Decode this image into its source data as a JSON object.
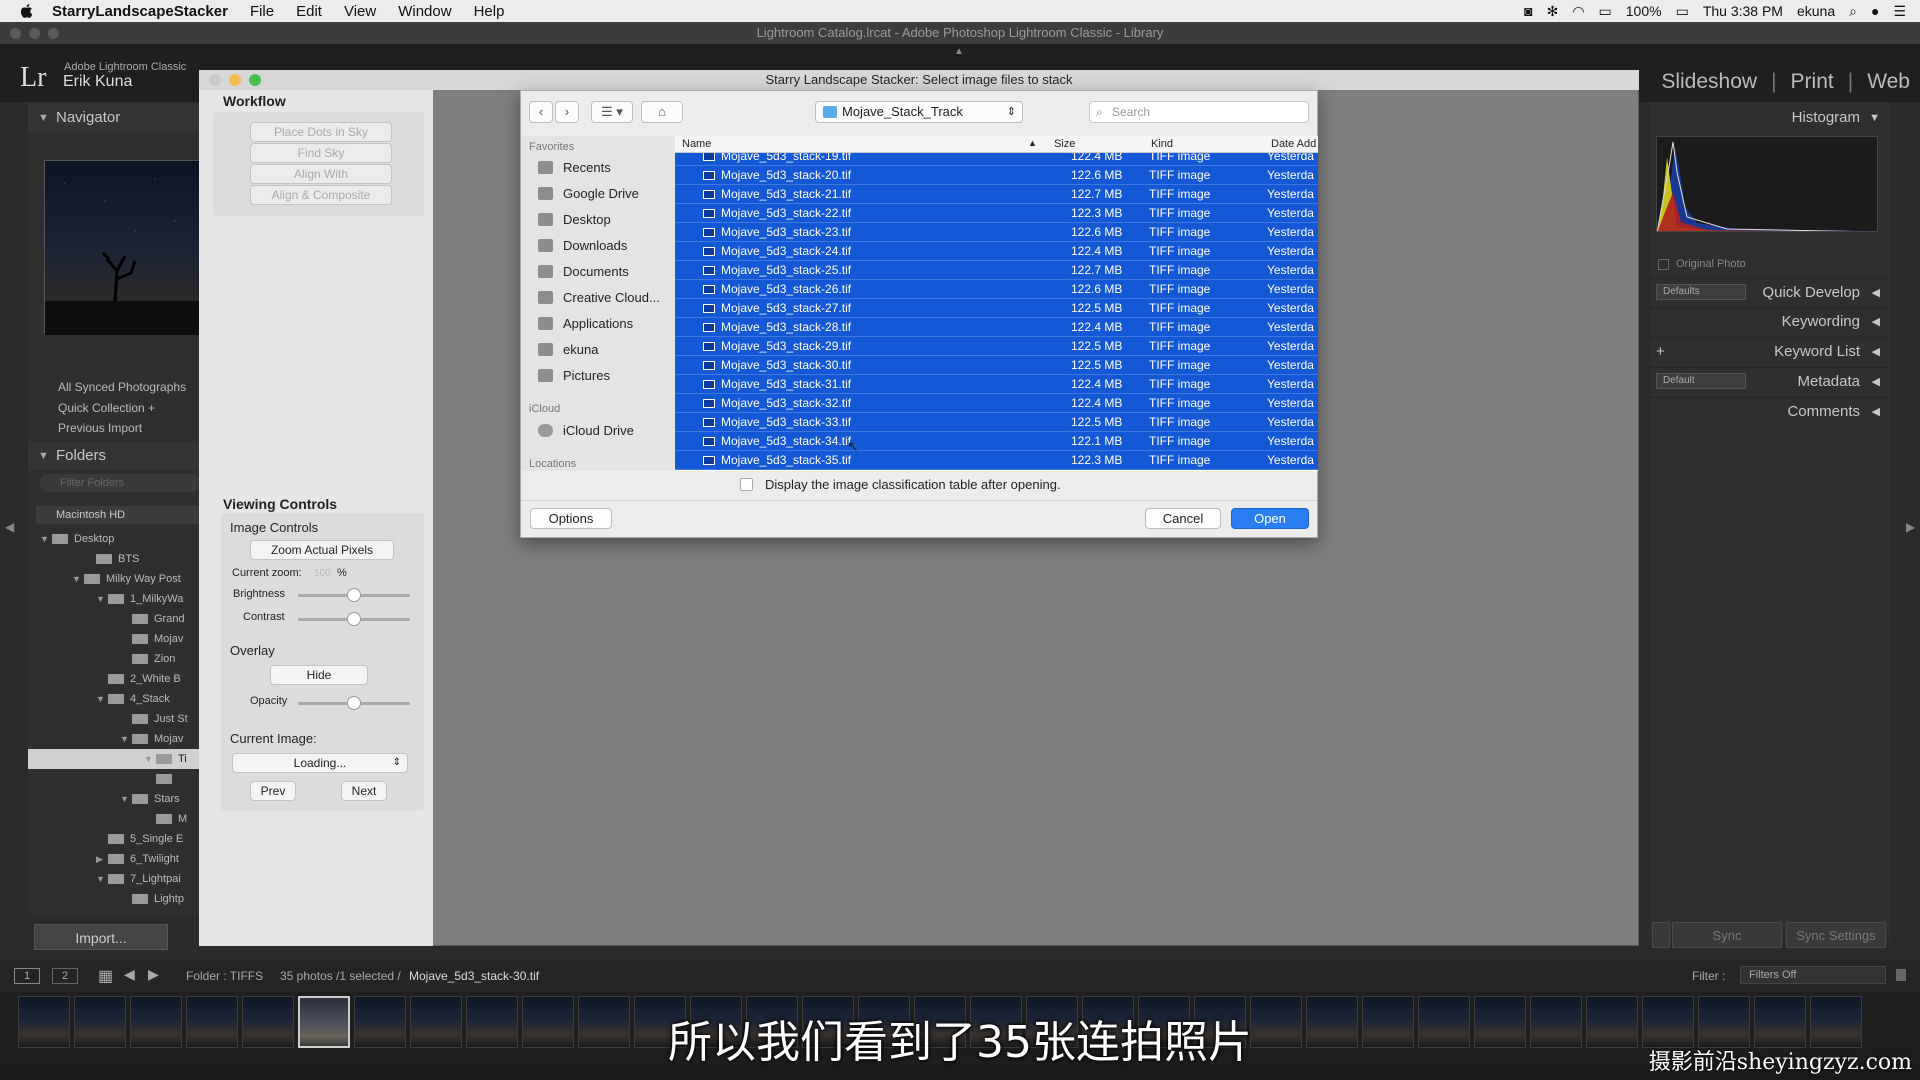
{
  "menubar": {
    "app_name": "StarryLandscapeStacker",
    "items": [
      "File",
      "Edit",
      "View",
      "Window",
      "Help"
    ],
    "battery": "100%",
    "clock": "Thu 3:38 PM",
    "user": "ekuna"
  },
  "window_title": "Lightroom Catalog.lrcat - Adobe Photoshop Lightroom Classic - Library",
  "lightroom": {
    "logo": "Lr",
    "product": "Adobe Lightroom Classic",
    "user_name": "Erik Kuna",
    "modules": [
      "Slideshow",
      "Print",
      "Web"
    ]
  },
  "left_panel": {
    "navigator": "Navigator",
    "catalog": [
      "All Synced Photographs",
      "Quick Collection +",
      "Previous Import"
    ],
    "folders_title": "Folders",
    "filter_placeholder": "Filter Folders",
    "volume": "Macintosh HD",
    "folders": [
      "Desktop",
      "BTS",
      "Milky Way Post",
      "1_MilkyWa",
      "Grand",
      "Mojav",
      "Zion",
      "2_White B",
      "4_Stack",
      "Just St",
      "Mojav",
      "Ti",
      "",
      "Stars",
      "M",
      "5_Single E",
      "6_Twilight",
      "7_Lightpai",
      "Lightp"
    ],
    "import_button": "Import..."
  },
  "right_panel": {
    "histogram": "Histogram",
    "original_photo": "Original Photo",
    "quick_develop": "Quick Develop",
    "quick_develop_preset": "Defaults",
    "keywording": "Keywording",
    "keyword_list": "Keyword List",
    "keyword_plus": "+",
    "metadata": "Metadata",
    "metadata_preset": "Default",
    "comments": "Comments",
    "sync": "Sync",
    "sync_settings": "Sync Settings"
  },
  "filmstrip_bar": {
    "page1": "1",
    "page2": "2",
    "folder_label": "Folder : TIFFS",
    "count": "35 photos /1 selected /",
    "selected_file": "Mojave_5d3_stack-30.tif",
    "filter_label": "Filter :",
    "filter_value": "Filters Off"
  },
  "stacker": {
    "title": "Starry Landscape Stacker: Select image files to stack",
    "workflow": "Workflow",
    "workflow_buttons": [
      "Place Dots in Sky",
      "Find Sky",
      "Align With",
      "Align & Composite"
    ],
    "viewing_controls": "Viewing Controls",
    "image_controls": "Image Controls",
    "zoom_button": "Zoom Actual Pixels",
    "current_zoom_label": "Current zoom:",
    "current_zoom_value": "100",
    "percent": "%",
    "brightness": "Brightness",
    "contrast": "Contrast",
    "overlay": "Overlay",
    "hide_button": "Hide",
    "opacity": "Opacity",
    "current_image": "Current Image:",
    "loading": "Loading...",
    "prev": "Prev",
    "next": "Next",
    "brightness_level": 0.5,
    "contrast_level": 0.5,
    "opacity_level": 0.5
  },
  "dialog": {
    "location": "Mojave_Stack_Track",
    "search_placeholder": "Search",
    "favorites_header": "Favorites",
    "favorites": [
      "Recents",
      "Google Drive",
      "Desktop",
      "Downloads",
      "Documents",
      "Creative Cloud...",
      "Applications",
      "ekuna",
      "Pictures"
    ],
    "icloud_header": "iCloud",
    "icloud": [
      "iCloud Drive"
    ],
    "locations_header": "Locations",
    "columns": {
      "name": "Name",
      "size": "Size",
      "kind": "Kind",
      "date": "Date Add"
    },
    "files": [
      {
        "name": "Mojave_5d3_stack-19.tif",
        "size": "122.4 MB",
        "kind": "TIFF image",
        "date": "Yesterda"
      },
      {
        "name": "Mojave_5d3_stack-20.tif",
        "size": "122.6 MB",
        "kind": "TIFF image",
        "date": "Yesterda"
      },
      {
        "name": "Mojave_5d3_stack-21.tif",
        "size": "122.7 MB",
        "kind": "TIFF image",
        "date": "Yesterda"
      },
      {
        "name": "Mojave_5d3_stack-22.tif",
        "size": "122.3 MB",
        "kind": "TIFF image",
        "date": "Yesterda"
      },
      {
        "name": "Mojave_5d3_stack-23.tif",
        "size": "122.6 MB",
        "kind": "TIFF image",
        "date": "Yesterda"
      },
      {
        "name": "Mojave_5d3_stack-24.tif",
        "size": "122.4 MB",
        "kind": "TIFF image",
        "date": "Yesterda"
      },
      {
        "name": "Mojave_5d3_stack-25.tif",
        "size": "122.7 MB",
        "kind": "TIFF image",
        "date": "Yesterda"
      },
      {
        "name": "Mojave_5d3_stack-26.tif",
        "size": "122.6 MB",
        "kind": "TIFF image",
        "date": "Yesterda"
      },
      {
        "name": "Mojave_5d3_stack-27.tif",
        "size": "122.5 MB",
        "kind": "TIFF image",
        "date": "Yesterda"
      },
      {
        "name": "Mojave_5d3_stack-28.tif",
        "size": "122.4 MB",
        "kind": "TIFF image",
        "date": "Yesterda"
      },
      {
        "name": "Mojave_5d3_stack-29.tif",
        "size": "122.5 MB",
        "kind": "TIFF image",
        "date": "Yesterda"
      },
      {
        "name": "Mojave_5d3_stack-30.tif",
        "size": "122.5 MB",
        "kind": "TIFF image",
        "date": "Yesterda"
      },
      {
        "name": "Mojave_5d3_stack-31.tif",
        "size": "122.4 MB",
        "kind": "TIFF image",
        "date": "Yesterda"
      },
      {
        "name": "Mojave_5d3_stack-32.tif",
        "size": "122.4 MB",
        "kind": "TIFF image",
        "date": "Yesterda"
      },
      {
        "name": "Mojave_5d3_stack-33.tif",
        "size": "122.5 MB",
        "kind": "TIFF image",
        "date": "Yesterda"
      },
      {
        "name": "Mojave_5d3_stack-34.tif",
        "size": "122.1 MB",
        "kind": "TIFF image",
        "date": "Yesterda"
      },
      {
        "name": "Mojave_5d3_stack-35.tif",
        "size": "122.3 MB",
        "kind": "TIFF image",
        "date": "Yesterda"
      }
    ],
    "classification_option": "Display the image classification table after opening.",
    "options_button": "Options",
    "cancel_button": "Cancel",
    "open_button": "Open"
  },
  "subtitle": "所以我们看到了35张连拍照片",
  "watermark": "摄影前沿sheyingzyz.com",
  "colors": {
    "selection": "#1558d6",
    "primary_button": "#2a7df1"
  }
}
